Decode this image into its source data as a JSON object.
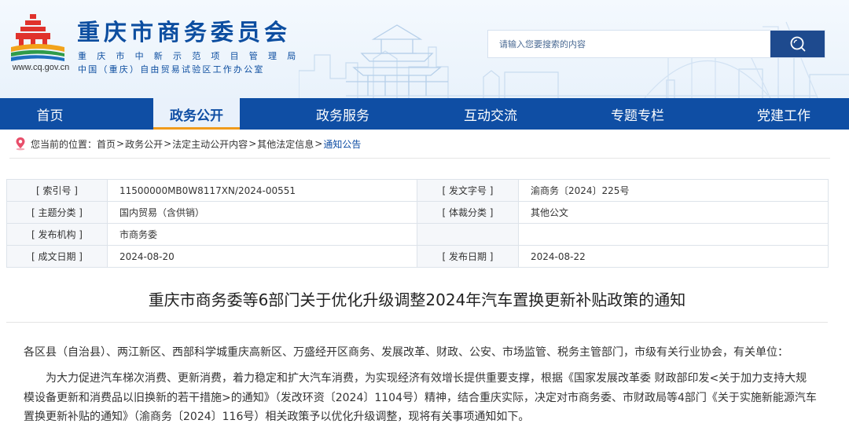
{
  "site": {
    "title": "重庆市商务委员会",
    "subtitle_line1": "重庆市中新示范项目管理局",
    "subtitle_line2": "中国（重庆）自由贸易试验区工作办公室",
    "url": "www.cq.gov.cn"
  },
  "search": {
    "placeholder": "请输入您要搜索的内容",
    "value": ""
  },
  "nav": {
    "items": [
      {
        "label": "首页",
        "active": false
      },
      {
        "label": "政务公开",
        "active": true
      },
      {
        "label": "政务服务",
        "active": false
      },
      {
        "label": "互动交流",
        "active": false
      },
      {
        "label": "专题专栏",
        "active": false
      },
      {
        "label": "党建工作",
        "active": false
      }
    ]
  },
  "breadcrumb": {
    "prefix": "您当前的位置：",
    "items": [
      "首页",
      "政务公开",
      "法定主动公开内容",
      "其他法定信息",
      "通知公告"
    ],
    "separator": ">"
  },
  "meta": {
    "index_label": "[ 索引号 ]",
    "index_value": "11500000MB0W8117XN/2024-00551",
    "doc_no_label": "[ 发文字号 ]",
    "doc_no_value": "渝商务〔2024〕225号",
    "topic_label": "[ 主题分类 ]",
    "topic_value": "国内贸易（含供销）",
    "genre_label": "[ 体裁分类 ]",
    "genre_value": "其他公文",
    "issuer_label": "[ 发布机构 ]",
    "issuer_value": "市商务委",
    "created_label": "[ 成文日期 ]",
    "created_value": "2024-08-20",
    "published_label": "[ 发布日期 ]",
    "published_value": "2024-08-22"
  },
  "article": {
    "title": "重庆市商务委等6部门关于优化升级调整2024年汽车置换更新补贴政策的通知",
    "para1": "各区县（自治县）、两江新区、西部科学城重庆高新区、万盛经开区商务、发展改革、财政、公安、市场监管、税务主管部门，市级有关行业协会，有关单位：",
    "para2": "为大力促进汽车梯次消费、更新消费，着力稳定和扩大汽车消费，为实现经济有效增长提供重要支撑，根据《国家发展改革委 财政部印发<关于加力支持大规模设备更新和消费品以旧换新的若干措施>的通知》（发改环资〔2024〕1104号）精神，结合重庆实际，决定对市商务委、市财政局等4部门《关于实施新能源汽车置换更新补贴的通知》（渝商务〔2024〕116号）相关政策予以优化升级调整，现将有关事项通知如下。"
  },
  "colors": {
    "brand_blue": "#0f4ea4",
    "nav_active_underline": "#f09b1c",
    "search_button": "#1e4a8e"
  }
}
